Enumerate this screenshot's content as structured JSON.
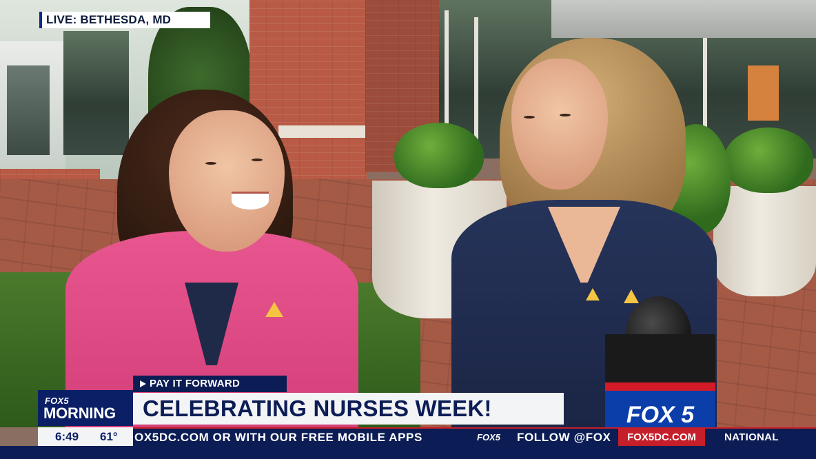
{
  "live_tag": "LIVE: BETHESDA, MD",
  "segment": {
    "kicker": "PAY IT FORWARD",
    "headline": "CELEBRATING NURSES WEEK!"
  },
  "logo": {
    "brand": "FOX5",
    "show": "MORNING"
  },
  "clock": {
    "time": "6:49",
    "temperature": "61°"
  },
  "ticker": {
    "text": "OX5DC.COM OR WITH OUR FREE MOBILE APPS",
    "station_mark": "FOX5",
    "follow": "FOLLOW @FOX",
    "url": "FOX5DC.COM",
    "section": "NATIONAL"
  },
  "microphone_flag": "FOX 5",
  "colors": {
    "navy": "#0c1d55",
    "red": "#c61e2a",
    "white": "#f3f4f6"
  }
}
